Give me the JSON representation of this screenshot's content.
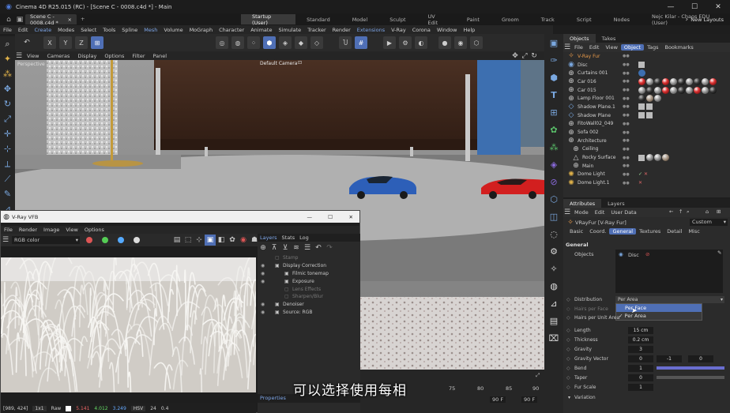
{
  "window": {
    "title": "Cinema 4D R25.015 (RC) - [Scene C - 0008.c4d *] - Main",
    "min": "—",
    "max": "☐",
    "close": "✕"
  },
  "doc_tab": {
    "label": "Scene C - 0008.c4d *",
    "close": "×"
  },
  "layout_tabs": [
    "Startup (User)",
    "Standard",
    "Model",
    "Sculpt",
    "UV Edit",
    "Paint",
    "Groom",
    "Track",
    "Script",
    "Nodes",
    "Nejc Kilar - Chaos EDU (User)"
  ],
  "new_layouts": "New Layouts",
  "menu": [
    "File",
    "Edit",
    "Create",
    "Modes",
    "Select",
    "Tools",
    "Spline",
    "Mesh",
    "Volume",
    "MoGraph",
    "Character",
    "Animate",
    "Simulate",
    "Tracker",
    "Render",
    "Extensions",
    "V-Ray",
    "Corona",
    "Window",
    "Help"
  ],
  "axis_buttons": [
    "X",
    "Y",
    "Z"
  ],
  "viewport_menu": [
    "View",
    "Cameras",
    "Display",
    "Options",
    "Filter",
    "Panel"
  ],
  "viewport": {
    "mode": "Perspective",
    "camera": "Default Camera"
  },
  "objects_panel": {
    "tabs": [
      "Objects",
      "Takes"
    ],
    "menu": [
      "File",
      "Edit",
      "View",
      "Object",
      "Tags",
      "Bookmarks"
    ],
    "items": [
      {
        "name": "V-Ray Fur"
      },
      {
        "name": "Disc"
      },
      {
        "name": "Curtains 001"
      },
      {
        "name": "Car 016"
      },
      {
        "name": "Car 015"
      },
      {
        "name": "Lamp Floor 001"
      },
      {
        "name": "Shadow Plane.1"
      },
      {
        "name": "Shadow Plane"
      },
      {
        "name": "FitoWall02_049"
      },
      {
        "name": "Sofa 002"
      },
      {
        "name": "Architecture"
      },
      {
        "name": "Ceiling"
      },
      {
        "name": "Rocky Surface"
      },
      {
        "name": "Main"
      },
      {
        "name": "Dome Light"
      },
      {
        "name": "Dome Light.1"
      }
    ]
  },
  "attributes_panel": {
    "tabs": [
      "Attributes",
      "Layers"
    ],
    "menu": [
      "Mode",
      "Edit",
      "User Data"
    ],
    "object": "VRayFur [V-Ray Fur]",
    "preset": "Custom",
    "sub_tabs": [
      "Basic",
      "Coord.",
      "General",
      "Textures",
      "Detail",
      "Misc"
    ],
    "section": "General",
    "objects_label": "Objects",
    "objects_list": [
      "Disc"
    ],
    "distribution": {
      "label": "Distribution",
      "value": "Per Area",
      "options": [
        "Per Face",
        "Per Area"
      ]
    },
    "hairs_per_face": "Hairs per Face",
    "hairs_per_unit_area": "Hairs per Unit Area",
    "params": [
      {
        "label": "Length",
        "value": "15 cm"
      },
      {
        "label": "Thickness",
        "value": "0.2 cm"
      },
      {
        "label": "Gravity",
        "value": "3"
      },
      {
        "label": "Gravity Vector",
        "value": "0",
        "v2": "-1",
        "v3": "0"
      },
      {
        "label": "Bend",
        "value": "1",
        "fill": 1.0
      },
      {
        "label": "Taper",
        "value": "0",
        "fill": 0.0
      },
      {
        "label": "Fur Scale",
        "value": "1"
      }
    ],
    "variation": "Variation"
  },
  "vfb": {
    "title": "V-Ray VFB",
    "min": "—",
    "max": "☐",
    "close": "✕",
    "menu": [
      "File",
      "Render",
      "Image",
      "View",
      "Options"
    ],
    "channel": "RGB color",
    "side_tabs": [
      "Layers",
      "Stats",
      "Log"
    ],
    "layers": [
      {
        "label": "Stamp",
        "on": false,
        "indent": 1
      },
      {
        "label": "Display Correction",
        "on": true,
        "indent": 1
      },
      {
        "label": "Filmic tonemap",
        "on": true,
        "indent": 2
      },
      {
        "label": "Exposure",
        "on": true,
        "indent": 2
      },
      {
        "label": "Lens Effects",
        "on": false,
        "indent": 2
      },
      {
        "label": "Sharpen/Blur",
        "on": false,
        "indent": 2
      },
      {
        "label": "Denoiser",
        "on": true,
        "indent": 1
      },
      {
        "label": "Source: RGB",
        "on": true,
        "indent": 1
      }
    ],
    "properties": "Properties",
    "status": {
      "coords": "[989, 424]",
      "zoom": "1x1",
      "mode": "Raw",
      "r": "5.141",
      "g": "4.012",
      "b": "3.249",
      "space": "HSV",
      "val": "24",
      "val2": "0.4"
    }
  },
  "timeline": {
    "ticks": [
      "75",
      "80",
      "85",
      "90"
    ],
    "start": "90 F",
    "end": "90 F"
  },
  "subtitle": "可以选择使用每相",
  "colors": {
    "accent": "#4f6fb5",
    "panel": "#2b2b2b",
    "bg": "#1e1e1e"
  }
}
